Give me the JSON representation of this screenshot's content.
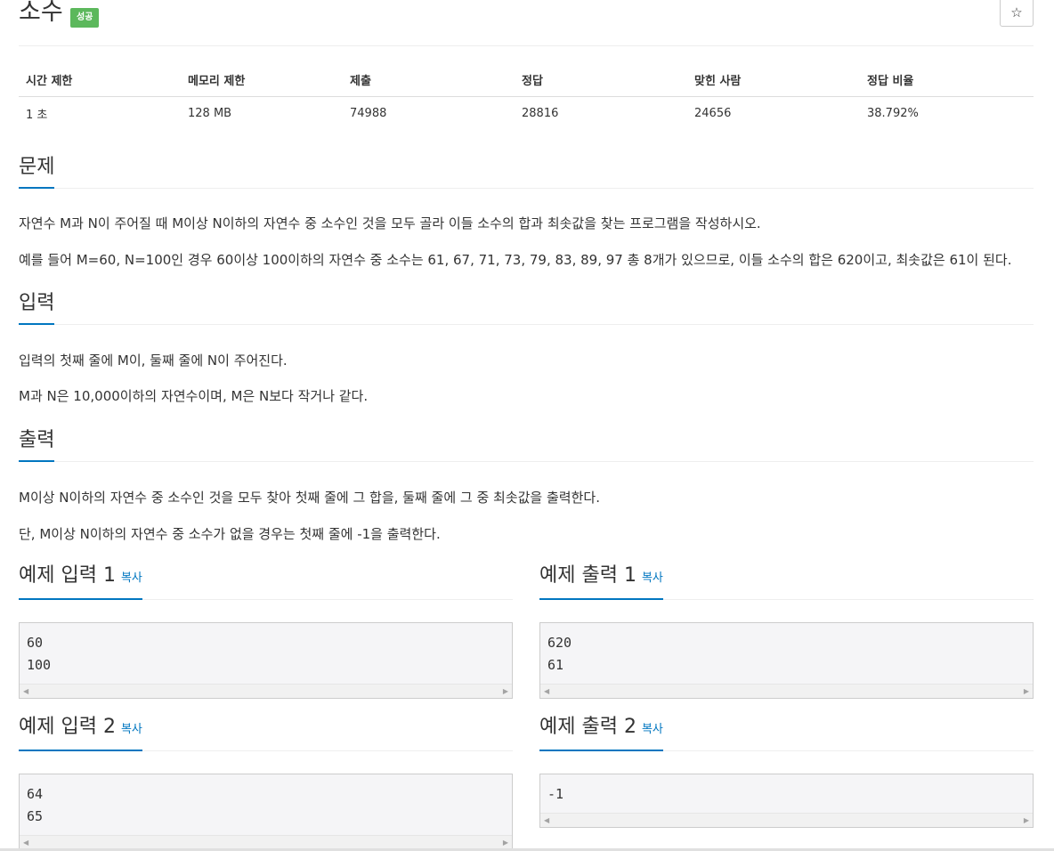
{
  "problem": {
    "title": "소수",
    "status_badge": "성공",
    "star_icon": "☆"
  },
  "info_table": {
    "headers": [
      "시간 제한",
      "메모리 제한",
      "제출",
      "정답",
      "맞힌 사람",
      "정답 비율"
    ],
    "values": [
      "1 초",
      "128 MB",
      "74988",
      "28816",
      "24656",
      "38.792%"
    ]
  },
  "sections": {
    "problem": {
      "heading": "문제",
      "paragraphs": [
        "자연수 M과 N이 주어질 때 M이상 N이하의 자연수 중 소수인 것을 모두 골라 이들 소수의 합과 최솟값을 찾는 프로그램을 작성하시오.",
        "예를 들어 M=60, N=100인 경우 60이상 100이하의 자연수 중 소수는 61, 67, 71, 73, 79, 83, 89, 97 총 8개가 있으므로, 이들 소수의 합은 620이고, 최솟값은 61이 된다."
      ]
    },
    "input": {
      "heading": "입력",
      "paragraphs": [
        "입력의 첫째 줄에 M이, 둘째 줄에 N이 주어진다.",
        "M과 N은 10,000이하의 자연수이며, M은 N보다 작거나 같다."
      ]
    },
    "output": {
      "heading": "출력",
      "paragraphs": [
        "M이상 N이하의 자연수 중 소수인 것을 모두 찾아 첫째 줄에 그 합을, 둘째 줄에 그 중 최솟값을 출력한다.",
        "단, M이상 N이하의 자연수 중 소수가 없을 경우는 첫째 줄에 -1을 출력한다."
      ]
    }
  },
  "samples": {
    "copy_label": "복사",
    "input1": {
      "heading": "예제 입력 1",
      "content": "60\n100"
    },
    "output1": {
      "heading": "예제 출력 1",
      "content": "620\n61"
    },
    "input2": {
      "heading": "예제 입력 2",
      "content": "64\n65"
    },
    "output2": {
      "heading": "예제 출력 2",
      "content": "-1"
    }
  },
  "scroll_arrows": {
    "left": "◀",
    "right": "▶"
  }
}
